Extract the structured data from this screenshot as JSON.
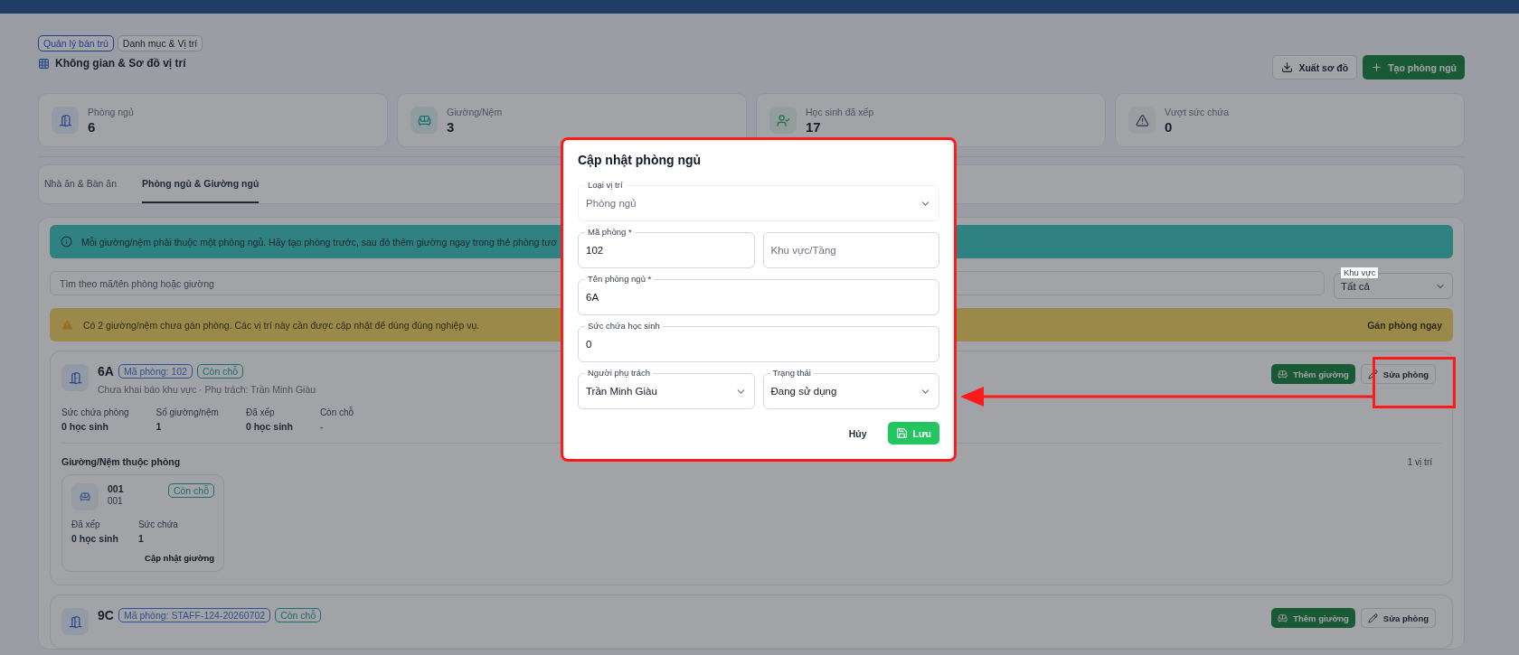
{
  "breadcrumbs": [
    {
      "label": "Quản lý bán trú",
      "selected": true
    },
    {
      "label": "Danh mục & Vị trí",
      "selected": false
    }
  ],
  "page_title": "Không gian & Sơ đồ vị trí",
  "actions": [
    {
      "label": "Xuất sơ đồ",
      "kind": "secondary"
    },
    {
      "label": "Tạo phòng ngủ",
      "kind": "primary"
    }
  ],
  "stats": [
    {
      "label": "Phòng ngủ",
      "value": "6",
      "kind": "room"
    },
    {
      "label": "Giường/Nệm",
      "value": "3",
      "kind": "bed"
    },
    {
      "label": "Học sinh đã xếp",
      "value": "17",
      "kind": "student"
    },
    {
      "label": "Vượt sức chứa",
      "value": "0",
      "kind": "warning"
    }
  ],
  "tabs": [
    {
      "label": "Nhà ăn & Bàn ăn",
      "selected": false
    },
    {
      "label": "Phòng ngủ & Giường ngủ",
      "selected": true
    }
  ],
  "info_banner": "Mỗi giường/nệm phải thuộc một phòng ngủ. Hãy tạo phòng trước, sau đó thêm giường ngay trong thẻ phòng tươ",
  "search": {
    "placeholder": "Tìm theo mã/tên phòng hoặc giường"
  },
  "area_filter": {
    "label": "Khu vực",
    "value": "Tất cả"
  },
  "warning": {
    "text": "Có 2 giường/nệm chưa gán phòng. Các vị trí này cần được cập nhật để dùng đúng nghiệp vụ.",
    "action": "Gán phòng ngay"
  },
  "rooms": [
    {
      "name": "6A",
      "code": "Mã phòng: 102",
      "status": "Còn chỗ",
      "subtitle": "Chưa khai báo khu vực · Phụ trách: Trần Minh Giàu",
      "stats": [
        {
          "label": "Sức chứa phòng",
          "value": "0 học sinh"
        },
        {
          "label": "Số giường/nệm",
          "value": "1"
        },
        {
          "label": "Đã xếp",
          "value": "0 học sinh"
        },
        {
          "label": "Còn chỗ",
          "value": "-"
        }
      ],
      "beds_title": "Giường/Nệm thuộc phòng",
      "beds_count": "1 vị trí",
      "beds": [
        {
          "name": "001",
          "code": "001",
          "status": "Còn chỗ",
          "stats": [
            {
              "label": "Đã xếp",
              "value": "0 học sinh"
            },
            {
              "label": "Sức chứa",
              "value": "1"
            }
          ],
          "action": "Cập nhật giường"
        }
      ],
      "actions": [
        "Thêm giường",
        "Sửa phòng"
      ]
    },
    {
      "name": "9C",
      "code": "Mã phòng: STAFF-124-20260702",
      "status": "Còn chỗ",
      "actions": [
        "Thêm giường",
        "Sửa phòng"
      ]
    }
  ],
  "dialog": {
    "title": "Cập nhật phòng ngủ",
    "rows": [
      [
        {
          "label": "Loại vị trí",
          "value": "Phòng ngủ",
          "kind": "select",
          "disabled": true
        }
      ],
      [
        {
          "label": "Mã phòng *",
          "value": "102",
          "kind": "text",
          "disabled": false
        },
        {
          "placeholder": "Khu vực/Tầng",
          "kind": "text",
          "disabled": false
        }
      ],
      [
        {
          "label": "Tên phòng ngủ *",
          "value": "6A",
          "kind": "text",
          "disabled": false
        }
      ],
      [
        {
          "label": "Sức chứa học sinh",
          "value": "0",
          "kind": "text",
          "disabled": false
        }
      ],
      [
        {
          "label": "Người phụ trách",
          "value": "Trần Minh Giàu",
          "kind": "select",
          "disabled": false
        },
        {
          "label": "Trạng thái",
          "value": "Đang sử dụng",
          "kind": "select",
          "disabled": false
        }
      ]
    ],
    "buttons": [
      {
        "label": "Hủy",
        "kind": "text"
      },
      {
        "label": "Lưu",
        "kind": "primary"
      }
    ]
  }
}
